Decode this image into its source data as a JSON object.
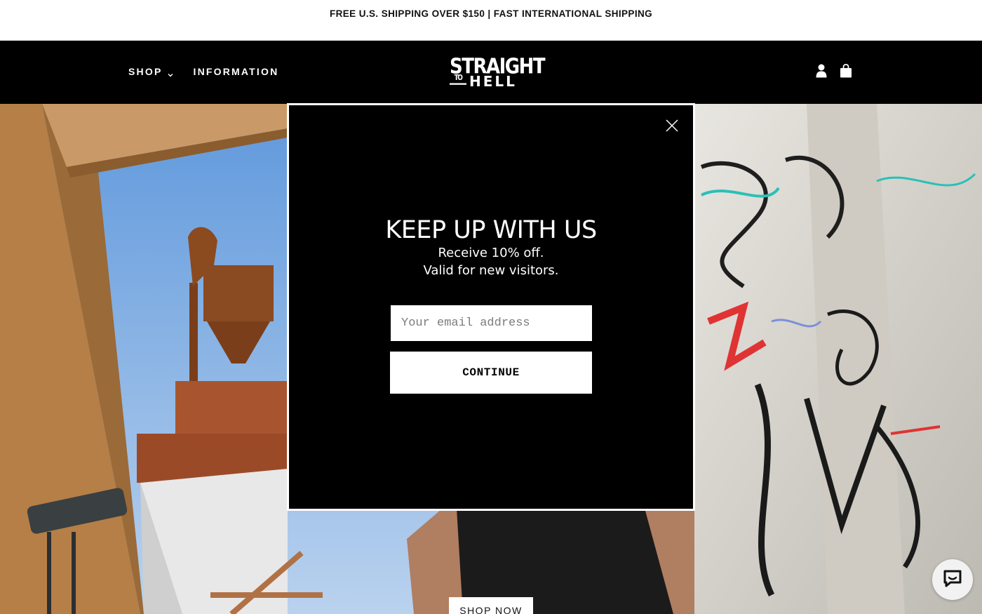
{
  "announcement": {
    "text": "FREE U.S. SHIPPING OVER $150 | FAST INTERNATIONAL SHIPPING"
  },
  "header": {
    "nav": [
      {
        "label": "SHOP",
        "has_dropdown": true,
        "icon": "chevron-down-icon"
      },
      {
        "label": "INFORMATION",
        "has_dropdown": false
      }
    ],
    "logo": {
      "line1": "STRAIGHT",
      "line2_small": "TO",
      "line2": "HELL"
    },
    "icons": [
      "account-icon",
      "shopping-bag-icon"
    ],
    "background": "#000000"
  },
  "hero": {
    "cta_label": "SHOP NOW",
    "description_colors": {
      "sky": "#7fb0e6",
      "wood": "#b57f47",
      "wall": "#d7d4cc"
    }
  },
  "popup": {
    "title": "KEEP UP WITH US",
    "subtitle_line1": "Receive 10% off.",
    "subtitle_line2": "Valid for new visitors.",
    "email_placeholder": "Your email address",
    "email_value": "",
    "continue_label": "CONTINUE",
    "close_icon": "close-icon",
    "background": "#000000",
    "border_color": "#ffffff"
  },
  "chat_widget": {
    "icon": "chat-bubble-icon"
  }
}
